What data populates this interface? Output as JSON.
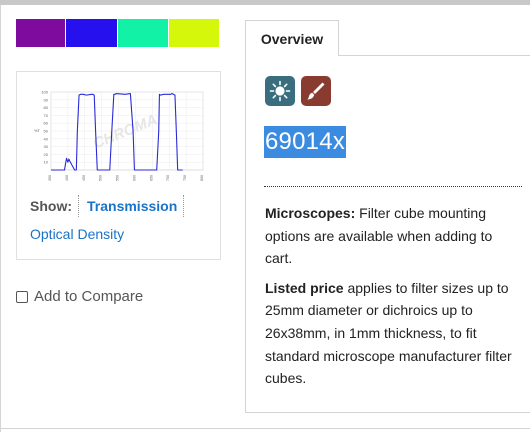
{
  "swatches": [
    {
      "name": "violet",
      "color": "#7f0b9e"
    },
    {
      "name": "blue",
      "color": "#2610ee"
    },
    {
      "name": "aqua",
      "color": "#12f2a6"
    },
    {
      "name": "yellow-green",
      "color": "#d5f80a"
    }
  ],
  "spectrum": {
    "show_label": "Show:",
    "transmission_link": "Transmission",
    "optical_density_link": "Optical Density",
    "watermark": "CHROMA",
    "chart_data": {
      "type": "line",
      "title": "",
      "xlabel": "",
      "ylabel": "%T",
      "xlim": [
        350,
        800
      ],
      "ylim": [
        0,
        100
      ],
      "yticks": [
        10,
        20,
        30,
        40,
        50,
        60,
        70,
        80,
        90,
        100
      ],
      "xticks": [
        350,
        400,
        450,
        500,
        550,
        600,
        650,
        700,
        750,
        800
      ],
      "series": [
        {
          "color": "#2a2ad8",
          "x": [
            350,
            390,
            393,
            396,
            400,
            403,
            406,
            420,
            425,
            428,
            433,
            437,
            445,
            455,
            470,
            474,
            478,
            482,
            487,
            493,
            503,
            524,
            530,
            536,
            540,
            543,
            570,
            585,
            593,
            597,
            600,
            603,
            608,
            618,
            630,
            645,
            650,
            663,
            669,
            671,
            675,
            683,
            705,
            708,
            713,
            717,
            721,
            725,
            740
          ],
          "y": [
            0,
            0,
            8,
            15,
            10,
            14,
            11,
            0,
            0,
            50,
            96,
            97,
            97,
            96,
            97,
            97,
            96,
            50,
            0,
            0,
            0,
            0,
            50,
            97,
            97,
            98,
            97,
            98,
            50,
            0,
            0,
            0,
            0,
            0,
            0,
            0,
            0,
            0,
            50,
            97,
            96,
            97,
            97,
            98,
            97,
            96,
            50,
            0,
            0
          ]
        }
      ]
    }
  },
  "compare": {
    "label": "Add to Compare"
  },
  "tabs": {
    "overview": "Overview"
  },
  "overview": {
    "icons": [
      "sun-icon",
      "brush-icon"
    ],
    "part_number": "69014x",
    "microscopes_label": "Microscopes:",
    "microscopes_text": "Filter cube mounting options are available when adding to cart.",
    "price_label": "Listed price",
    "price_text": "applies to filter sizes up to 25mm diameter or dichroics up to 26x38mm, in 1mm thickness, to fit standard microscope manufacturer filter cubes."
  }
}
